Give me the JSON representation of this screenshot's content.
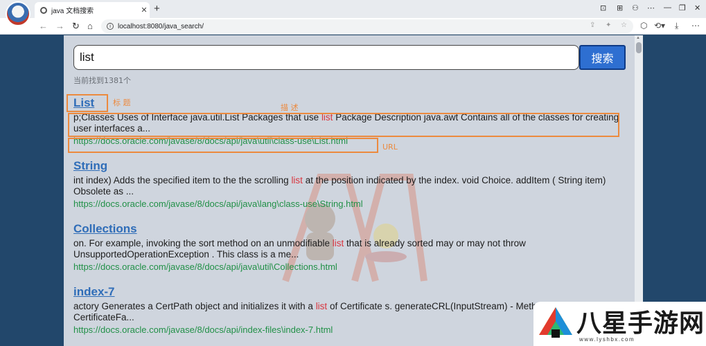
{
  "browser": {
    "tab_title": "java 文档搜索",
    "tab_close": "✕",
    "new_tab": "+",
    "url": "localhost:8080/java_search/",
    "info_icon": "i",
    "nav": {
      "back": "←",
      "forward": "→",
      "reload": "↻",
      "home": "⌂"
    },
    "window_controls": [
      "⊡",
      "⊞",
      "⚇",
      "⋯",
      "—",
      "❐",
      "✕"
    ],
    "toolbar": [
      "⬡",
      "⟲▾",
      "⤓",
      "⋯"
    ]
  },
  "search": {
    "query": "list",
    "button_label": "搜索",
    "result_count": "当前找到1381个"
  },
  "results": [
    {
      "title": "List",
      "desc_pre": "p;Classes Uses of Interface java.util.List Packages that use ",
      "highlight": "list",
      "desc_post": "   Package Description java.awt Contains all of the classes for creating user interfaces a...",
      "url": "https://docs.oracle.com/javase/8/docs/api/java\\util\\class-use\\List.html"
    },
    {
      "title": "String",
      "desc_pre": "int index) Adds the specified item to the the scrolling ",
      "highlight": "list",
      "desc_post": " at the position indicated by the index. void Choice. addItem ( String  item) Obsolete as ...",
      "url": "https://docs.oracle.com/javase/8/docs/api/java\\lang\\class-use\\String.html"
    },
    {
      "title": "Collections",
      "desc_pre": "on. For example, invoking the sort method on an unmodifiable ",
      "highlight": "list",
      "desc_post": " that is already sorted may or may not throw UnsupportedOperationException . This class is a me...",
      "url": "https://docs.oracle.com/javase/8/docs/api/java\\util\\Collections.html"
    },
    {
      "title": "index-7",
      "desc_pre": "actory Generates a CertPath object and initializes it with a ",
      "highlight": "list",
      "desc_post": " of Certificate s. generateCRL(InputStream) - Meth java.security.cert. CertificateFa...",
      "url": "https://docs.oracle.com/javase/8/docs/api/index-files\\index-7.html"
    }
  ],
  "annotations": {
    "title_label": "标 题",
    "desc_label": "描 述",
    "url_label": "URL",
    "box_color": "#ec8a3e"
  },
  "watermark": {
    "text": "八星手游网",
    "url": "www.lyshbx.com"
  },
  "colors": {
    "title_link": "#2f6db8",
    "highlight": "#d9353e",
    "url_link": "#219047",
    "search_button": "#2e6fd1",
    "page_background": "#22476b"
  }
}
